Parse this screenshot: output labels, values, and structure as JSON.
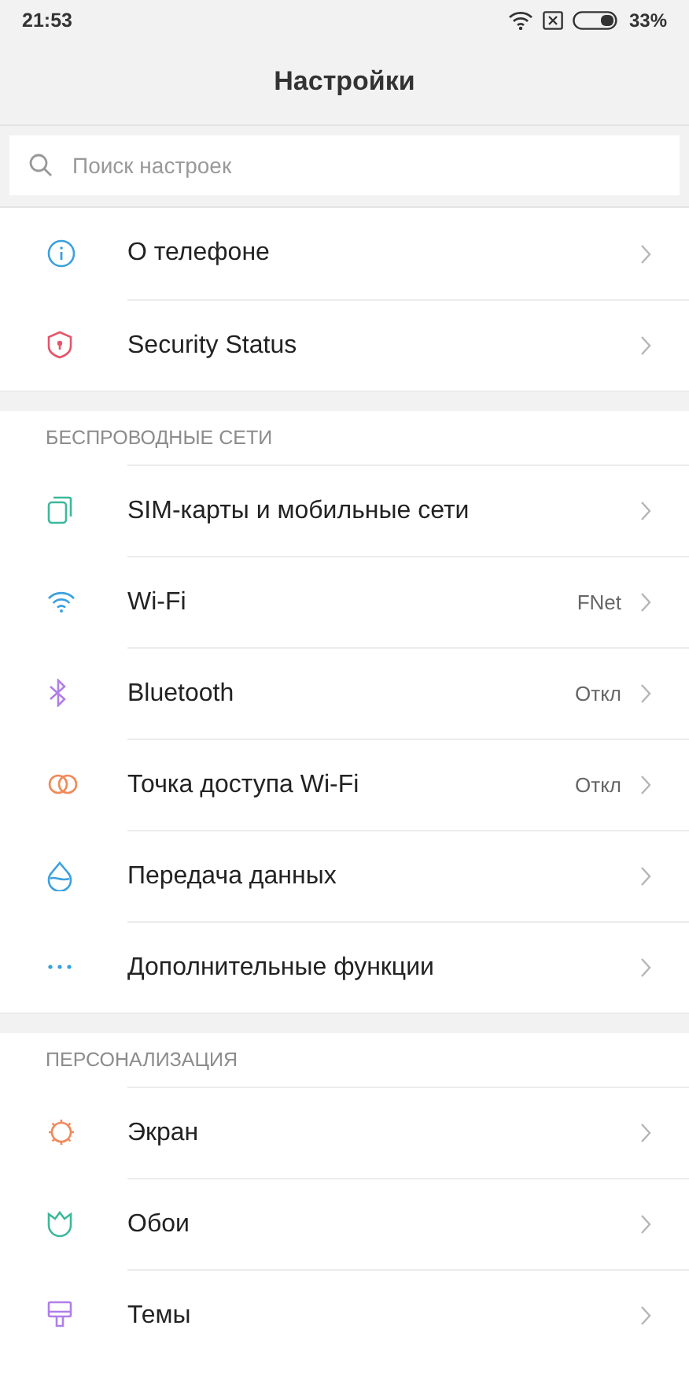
{
  "status_bar": {
    "time": "21:53",
    "battery": "33%"
  },
  "header": {
    "title": "Настройки"
  },
  "search": {
    "placeholder": "Поиск настроек"
  },
  "groups": [
    {
      "items": [
        {
          "kind": "info",
          "label": "О телефоне"
        },
        {
          "kind": "shield",
          "label": "Security Status"
        }
      ]
    },
    {
      "title": "БЕСПРОВОДНЫЕ СЕТИ",
      "items": [
        {
          "kind": "sim",
          "label": "SIM-карты и мобильные сети"
        },
        {
          "kind": "wifi",
          "label": "Wi-Fi",
          "value": "FNet"
        },
        {
          "kind": "bluetooth",
          "label": "Bluetooth",
          "value": "Откл"
        },
        {
          "kind": "hotspot",
          "label": "Точка доступа Wi-Fi",
          "value": "Откл"
        },
        {
          "kind": "drop",
          "label": "Передача данных"
        },
        {
          "kind": "dots",
          "label": "Дополнительные функции"
        }
      ]
    },
    {
      "title": "ПЕРСОНАЛИЗАЦИЯ",
      "items": [
        {
          "kind": "sun",
          "label": "Экран"
        },
        {
          "kind": "flower",
          "label": "Обои"
        },
        {
          "kind": "brush",
          "label": "Темы"
        }
      ]
    }
  ]
}
